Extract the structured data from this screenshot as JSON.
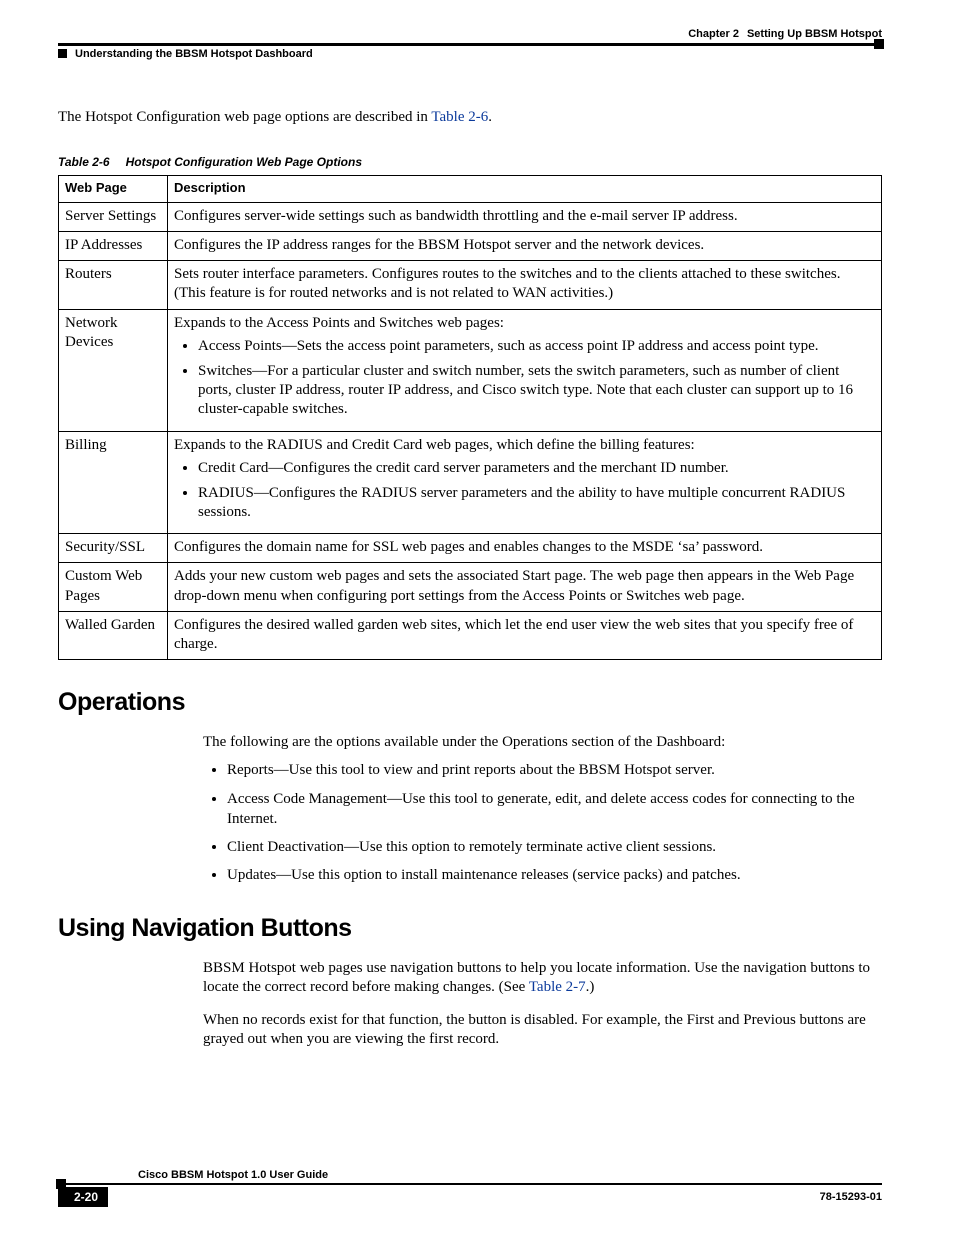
{
  "header": {
    "chapter_label": "Chapter 2",
    "chapter_title": "Setting Up BBSM Hotspot",
    "section_title": "Understanding the BBSM Hotspot Dashboard"
  },
  "intro_before_link": "The Hotspot Configuration web page options are described in ",
  "intro_link": "Table 2-6",
  "intro_after_link": ".",
  "table": {
    "caption_num": "Table 2-6",
    "caption_title": "Hotspot Configuration Web Page Options",
    "col1": "Web Page",
    "col2": "Description",
    "rows": {
      "server_settings": {
        "name": "Server Settings",
        "desc": "Configures server-wide settings such as bandwidth throttling and the e-mail server IP address."
      },
      "ip_addresses": {
        "name": "IP Addresses",
        "desc": "Configures the IP address ranges for the BBSM Hotspot server and the network devices."
      },
      "routers": {
        "name": "Routers",
        "desc": "Sets router interface parameters. Configures routes to the switches and to the clients attached to these switches. (This feature is for routed networks and is not related to WAN activities.)"
      },
      "network_devices": {
        "name": "Network Devices",
        "lead": "Expands to the Access Points and Switches web pages:",
        "b1": "Access Points—Sets the access point parameters, such as access point IP address and access point type.",
        "b2": "Switches—For a particular cluster and switch number, sets the switch parameters, such as number of client ports, cluster IP address, router IP address, and Cisco switch type. Note that each cluster can support up to 16 cluster-capable switches."
      },
      "billing": {
        "name": "Billing",
        "lead": "Expands to the RADIUS and Credit Card web pages, which define the billing features:",
        "b1": "Credit Card—Configures the credit card server parameters and the merchant ID number.",
        "b2": "RADIUS—Configures the RADIUS server parameters and the ability to have multiple concurrent RADIUS sessions."
      },
      "security_ssl": {
        "name": "Security/SSL",
        "desc": "Configures the domain name for SSL web pages and enables changes to the MSDE ‘sa’ password."
      },
      "custom_web": {
        "name": "Custom Web Pages",
        "desc": "Adds your new custom web pages and sets the associated Start page. The web page then appears in the Web Page drop-down menu when configuring port settings from the Access Points or Switches web page."
      },
      "walled_garden": {
        "name": "Walled Garden",
        "desc": "Configures the desired walled garden web sites, which let the end user view the web sites that you specify free of charge."
      }
    }
  },
  "operations": {
    "heading": "Operations",
    "intro": "The following are the options available under the Operations section of the Dashboard:",
    "b1": "Reports—Use this tool to view and print reports about the BBSM Hotspot server.",
    "b2": "Access Code Management—Use this tool to generate, edit, and delete access codes for connecting to the Internet.",
    "b3": "Client Deactivation—Use this option to remotely terminate active client sessions.",
    "b4": "Updates—Use this option to install maintenance releases (service packs) and patches."
  },
  "nav": {
    "heading": "Using Navigation Buttons",
    "p1_before": "BBSM Hotspot web pages use navigation buttons to help you locate information. Use the navigation buttons to locate the correct record before making changes. (See ",
    "p1_link": "Table 2-7",
    "p1_after": ".)",
    "p2": "When no records exist for that function, the button is disabled. For example, the First and Previous buttons are grayed out when you are viewing the first record."
  },
  "footer": {
    "guide": "Cisco BBSM Hotspot 1.0 User Guide",
    "page": "2-20",
    "docnum": "78-15293-01"
  }
}
